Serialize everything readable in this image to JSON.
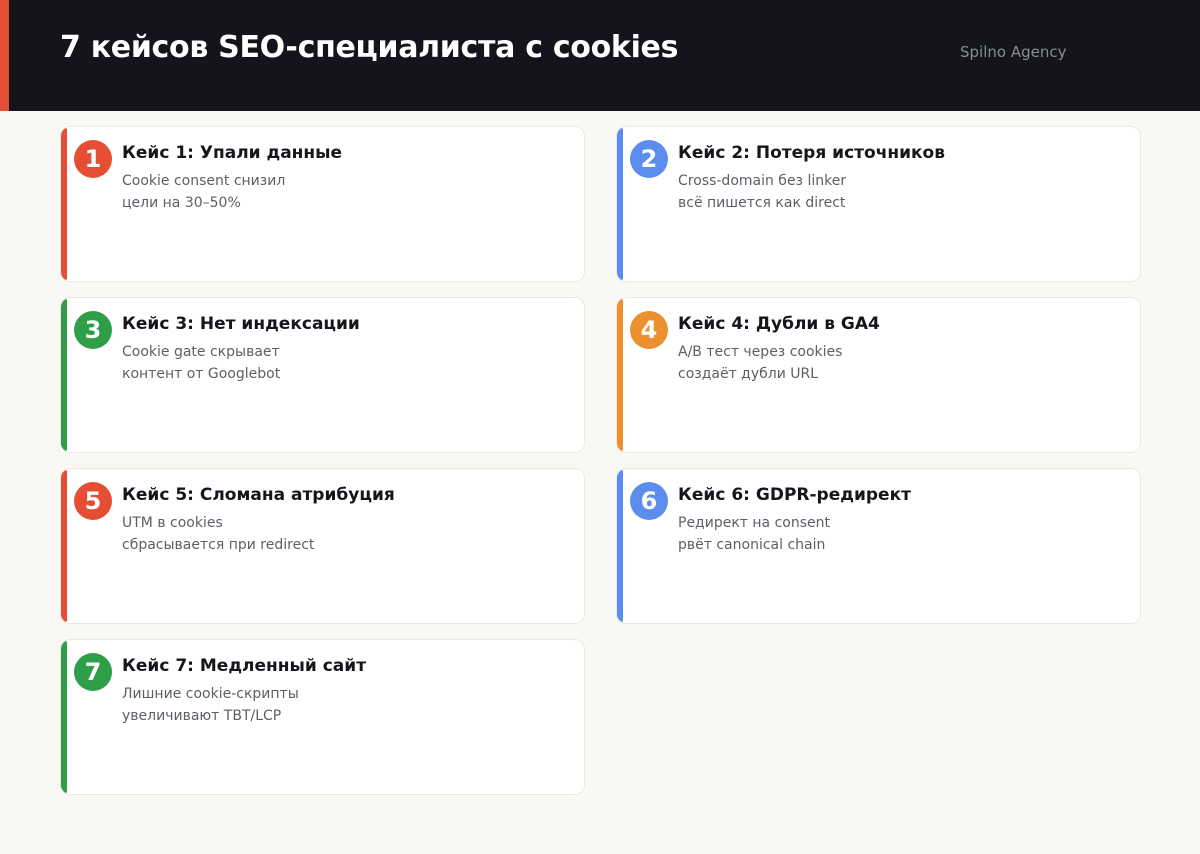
{
  "header": {
    "title": "7 кейсов SEO-специалиста с cookies",
    "brand": "Spilno Agency",
    "accent_color": "#e54e33",
    "background_color": "#13141c"
  },
  "cases": [
    {
      "number": "1",
      "title": "Кейс 1: Упали данные",
      "line1": "Cookie consent снизил",
      "line2": "цели на 30–50%",
      "color": "#e54e33"
    },
    {
      "number": "2",
      "title": "Кейс 2: Потеря источников",
      "line1": "Cross-domain без linker",
      "line2": "всё пишется как direct",
      "color": "#5b8def"
    },
    {
      "number": "3",
      "title": "Кейс 3: Нет индексации",
      "line1": "Cookie gate скрывает",
      "line2": "контент от Googlebot",
      "color": "#2e9e48"
    },
    {
      "number": "4",
      "title": "Кейс 4: Дубли в GA4",
      "line1": "A/B тест через cookies",
      "line2": "создаёт дубли URL",
      "color": "#ec8f2f"
    },
    {
      "number": "5",
      "title": "Кейс 5: Сломана атрибуция",
      "line1": "UTM в cookies",
      "line2": "сбрасывается при redirect",
      "color": "#e54e33"
    },
    {
      "number": "6",
      "title": "Кейс 6: GDPR-редирект",
      "line1": "Редирект на consent",
      "line2": "рвёт canonical chain",
      "color": "#5b8def"
    },
    {
      "number": "7",
      "title": "Кейс 7: Медленный сайт",
      "line1": "Лишние cookie-скрипты",
      "line2": "увеличивают TBT/LCP",
      "color": "#2e9e48"
    }
  ]
}
